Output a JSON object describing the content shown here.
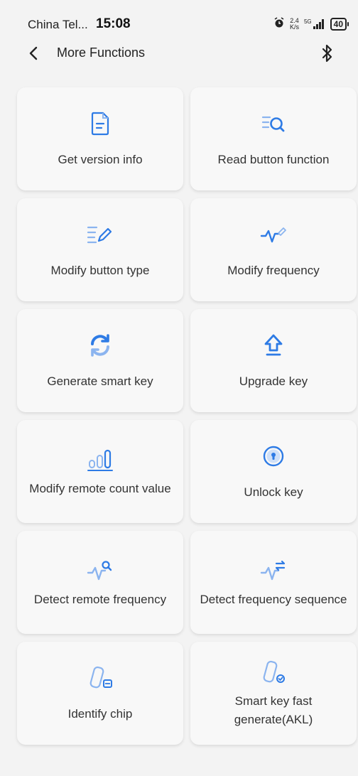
{
  "status_bar": {
    "carrier": "China Tel...",
    "time": "15:08",
    "net_speed_top": "2.4",
    "net_speed_bottom": "K/s",
    "network": "5G",
    "battery": "40"
  },
  "header": {
    "title": "More Functions"
  },
  "cards": [
    {
      "label": "Get version info",
      "icon": "document-icon"
    },
    {
      "label": "Read button function",
      "icon": "list-search-icon"
    },
    {
      "label": "Modify button type",
      "icon": "list-edit-icon"
    },
    {
      "label": "Modify frequency",
      "icon": "wave-edit-icon"
    },
    {
      "label": "Generate smart key",
      "icon": "refresh-icon"
    },
    {
      "label": "Upgrade key",
      "icon": "upload-arrow-icon"
    },
    {
      "label": "Modify remote count value",
      "icon": "counter-icon"
    },
    {
      "label": "Unlock key",
      "icon": "lock-icon"
    },
    {
      "label": "Detect remote frequency",
      "icon": "wave-search-icon"
    },
    {
      "label": "Detect frequency sequence",
      "icon": "wave-switch-icon"
    },
    {
      "label": "Identify chip",
      "icon": "chip-icon"
    },
    {
      "label": "Smart key fast generate(AKL)",
      "icon": "chip-check-icon"
    }
  ],
  "colors": {
    "accent": "#2e7be5",
    "accent_light": "#8bb4ef",
    "background": "#f3f3f3",
    "card": "#f8f8f8"
  }
}
